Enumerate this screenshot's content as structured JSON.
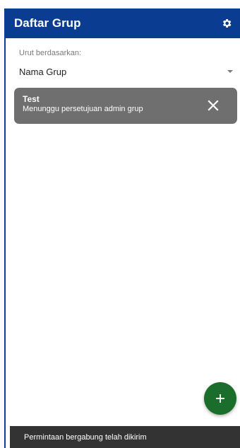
{
  "app_bar": {
    "title": "Daftar Grup",
    "background": "#0a3d91",
    "settings_icon": "gear-icon"
  },
  "sort": {
    "label": "Urut berdasarkan:",
    "selected": "Nama Grup"
  },
  "groups": [
    {
      "name": "Test",
      "status": "Menunggu persetujuan admin grup",
      "action_icon": "close-icon"
    }
  ],
  "fab": {
    "icon": "plus-icon",
    "color": "#1b6d2b"
  },
  "snackbar": {
    "message": "Permintaan bergabung telah dikirim"
  }
}
